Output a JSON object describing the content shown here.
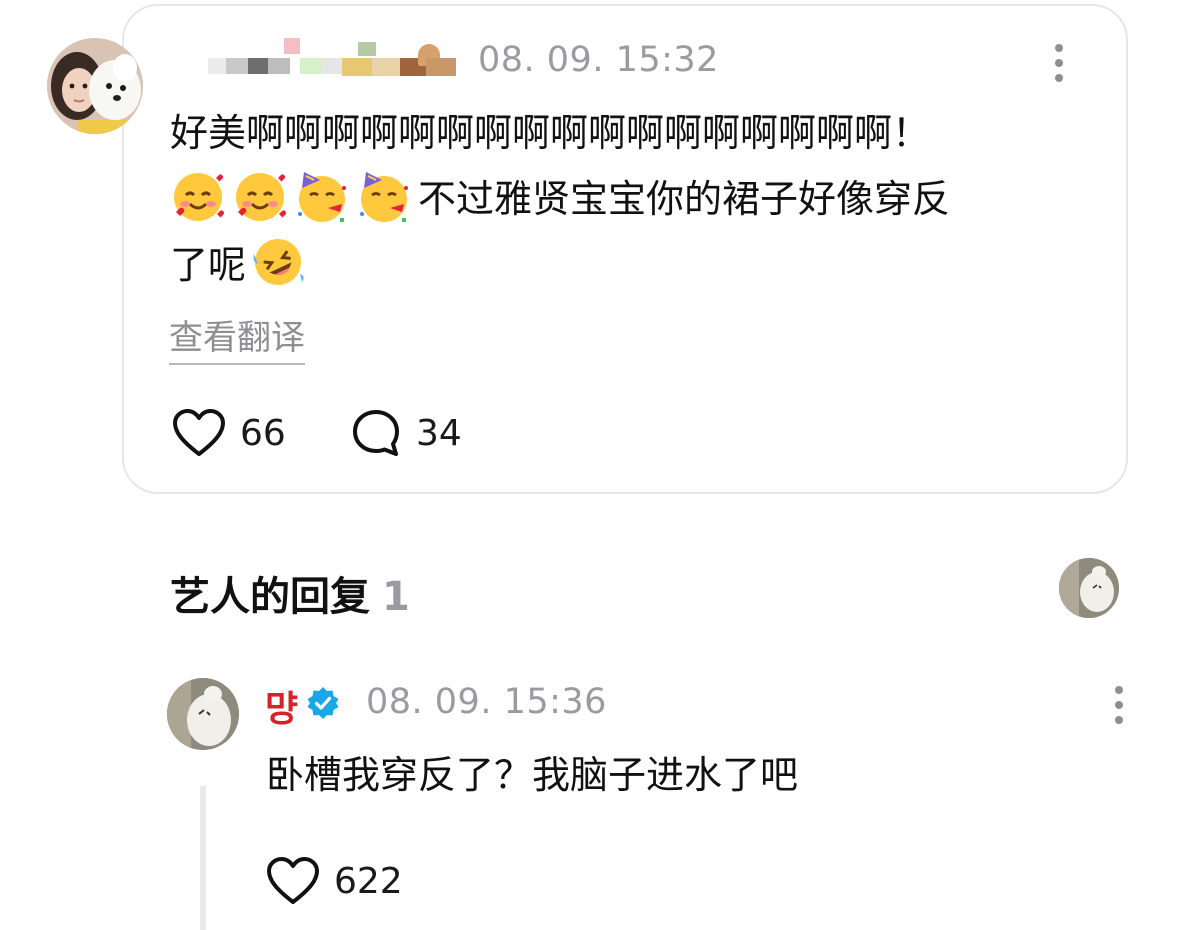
{
  "fan_comment": {
    "timestamp": "08. 09. 15:32",
    "text_line1": "好美啊啊啊啊啊啊啊啊啊啊啊啊啊啊啊啊啊！",
    "text_line2_suffix": "不过雅贤宝宝你的裙子好像穿反",
    "text_line3_prefix": "了呢",
    "emojis": [
      "smiling-face-with-hearts-emoji",
      "smiling-face-with-hearts-emoji",
      "partying-face-emoji",
      "partying-face-emoji",
      "rolling-on-floor-laughing-emoji"
    ],
    "translate_label": "查看翻译",
    "like_count": "66",
    "reply_count": "34"
  },
  "artist_section": {
    "title": "艺人的回复",
    "count": "1"
  },
  "artist_reply": {
    "name": "먕",
    "timestamp": "08. 09. 15:36",
    "text": "卧槽我穿反了？我脑子进水了吧",
    "like_count": "622"
  },
  "colors": {
    "artist_name": "#d6232a",
    "verified_badge": "#1aa7e8",
    "muted_text": "#9a9aa0",
    "card_border": "#e6e6ea"
  }
}
